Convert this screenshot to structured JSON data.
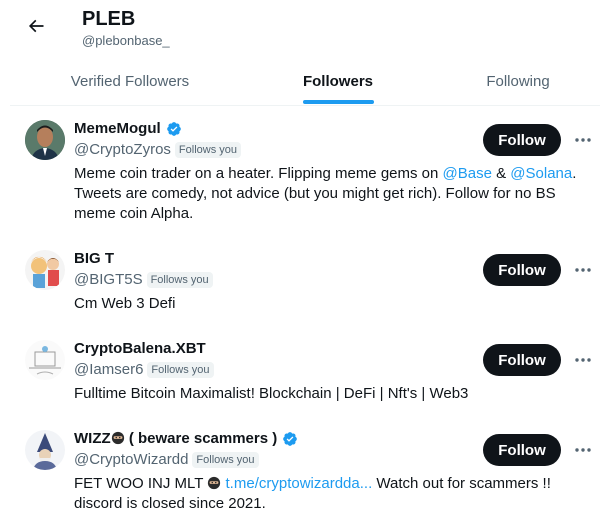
{
  "header": {
    "title": "PLEB",
    "handle": "@plebonbase_"
  },
  "tabs": [
    {
      "label": "Verified Followers"
    },
    {
      "label": "Followers"
    },
    {
      "label": "Following"
    }
  ],
  "accent_color": "#1d9bf0",
  "users": [
    {
      "name": "MemeMogul",
      "handle": "@CryptoZyros",
      "follows_you": "Follows you",
      "follow_label": "Follow",
      "bio_parts": [
        "Meme coin trader on a heater. Flipping meme gems on ",
        "@Base",
        " & ",
        "@Solana",
        ".",
        "Tweets are comedy, not advice (but you might get rich). Follow for no BS",
        "meme coin Alpha."
      ]
    },
    {
      "name": "BIG T",
      "handle": "@BIGT5S",
      "follows_you": "Follows you",
      "follow_label": "Follow",
      "bio": "Cm Web 3 Defi"
    },
    {
      "name": "CryptoBalena.XBT",
      "handle": "@Iamser6",
      "follows_you": "Follows you",
      "follow_label": "Follow",
      "bio": "Fulltime Bitcoin Maximalist! Blockchain | DeFi | Nft's | Web3"
    },
    {
      "name_a": "WIZZ",
      "name_b": " ( beware scammers )",
      "handle": "@CryptoWizardd",
      "follows_you": "Follows you",
      "follow_label": "Follow",
      "bio_a": "FET WOO INJ MLT ",
      "bio_link": "t.me/cryptowizardda...",
      "bio_b": " Watch out for scammers !!",
      "bio_c": "discord is closed since 2021."
    }
  ]
}
